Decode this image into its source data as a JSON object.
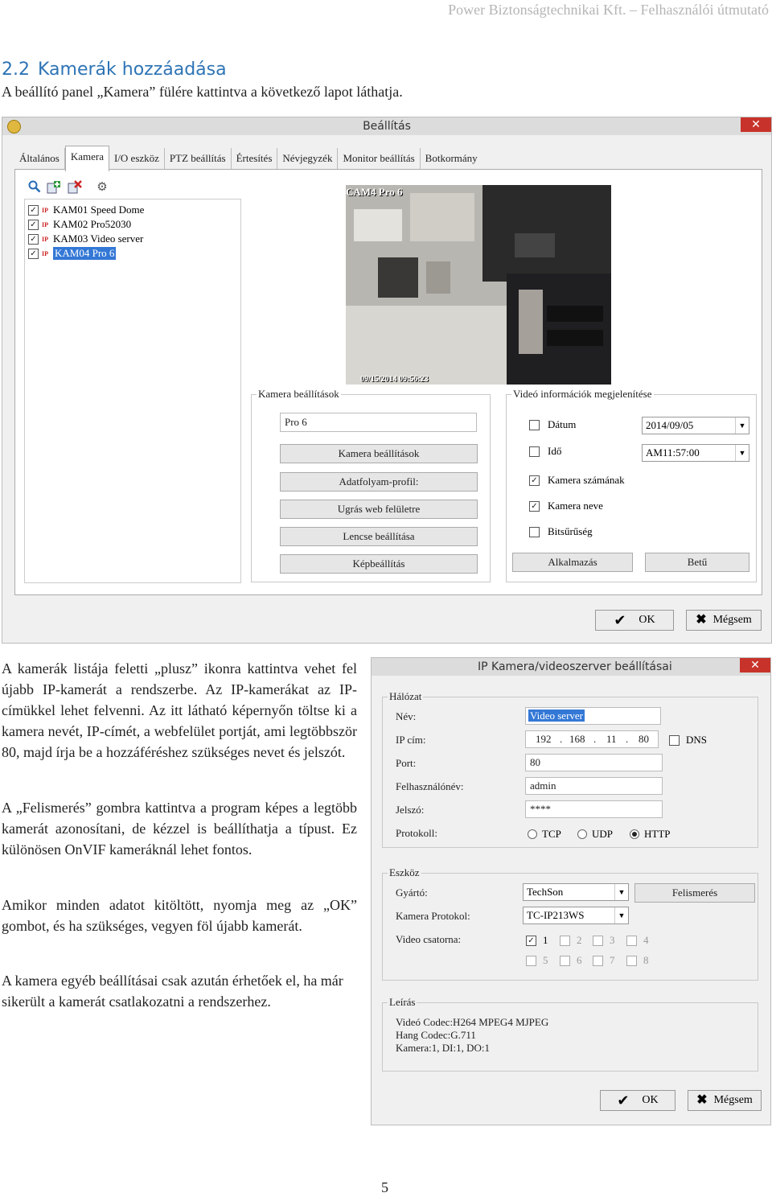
{
  "header": "Power Biztonságtechnikai Kft. – Felhasználói útmutató",
  "section": {
    "number": "2.2",
    "title": "Kamerák hozzáadása"
  },
  "intro": "A beállító panel „Kamera” fülére kattintva a következő lapot láthatja.",
  "settings_window": {
    "title": "Beállítás",
    "close": "✕",
    "tabs": [
      "Általános",
      "Kamera",
      "I/O eszköz",
      "PTZ beállítás",
      "Értesítés",
      "Névjegyzék",
      "Monitor beállítás",
      "Botkormány"
    ],
    "active_tab": "Kamera",
    "toolbar_icons": [
      "search-icon",
      "add-icon",
      "delete-icon",
      "gear-icon"
    ],
    "cameras": [
      {
        "tag": "IP",
        "label": "KAM01 Speed Dome",
        "checked": true
      },
      {
        "tag": "IP",
        "label": "KAM02 Pro52030",
        "checked": true
      },
      {
        "tag": "IP",
        "label": "KAM03 Video server",
        "checked": true
      },
      {
        "tag": "IP",
        "label": "KAM04 Pro 6",
        "checked": true,
        "selected": true
      }
    ],
    "video_overlay": {
      "camera_label": "CAM4 Pro 6",
      "timestamp": "09/15/2014 09:56:23"
    },
    "camera_settings": {
      "legend": "Kamera beállítások",
      "name_value": "Pro 6",
      "buttons": [
        "Kamera beállítások",
        "Adatfolyam-profil:",
        "Ugrás web felületre",
        "Lencse beállítása",
        "Képbeállítás"
      ]
    },
    "video_info": {
      "legend": "Videó információk megjelenítése",
      "date_label": "Dátum",
      "date_value": "2014/09/05",
      "time_label": "Idő",
      "time_value": "AM11:57:00",
      "camera_number_label": "Kamera számának",
      "camera_name_label": "Kamera neve",
      "bitrate_label": "Bitsűrűség",
      "apply_button": "Alkalmazás",
      "font_button": "Betű"
    },
    "ok": "OK",
    "cancel": "Mégsem"
  },
  "paragraphs": [
    "A kamerák listája feletti „plusz” ikonra kattintva vehet fel újabb IP-kamerát a rendszerbe. Az IP-kamerákat az IP-címükkel lehet felvenni. Az itt látható képernyőn töltse ki a kamera nevét, IP-címét, a webfelület portját, ami legtöbbször 80, majd írja be a hozzáféréshez szükséges nevet és jelszót.",
    "A „Felismerés” gombra kattintva a program képes a legtöbb kamerát azonosítani, de kézzel is beállíthatja a típust. Ez különösen OnVIF kameráknál lehet fontos.",
    "Amikor minden adatot kitöltött, nyomja meg az „OK” gombot, és ha szükséges, vegyen föl újabb kamerát.",
    "A kamera egyéb beállításai csak azután érhetőek el, ha már sikerült a kamerát csatlakozatni a rendszerhez."
  ],
  "ip_window": {
    "title": "IP Kamera/videoszerver beállításai",
    "close": "✕",
    "network_legend": "Hálózat",
    "name_label": "Név:",
    "name_value": "Video server",
    "ip_label": "IP cím:",
    "ip_parts": [
      "192",
      "168",
      "11",
      "80"
    ],
    "ip_dots": [
      ".",
      ".",
      "."
    ],
    "dns_label": "DNS",
    "port_label": "Port:",
    "port_value": "80",
    "user_label": "Felhasználónév:",
    "user_value": "admin",
    "password_label": "Jelszó:",
    "password_value": "****",
    "protocol_label": "Protokoll:",
    "protocols": [
      "TCP",
      "UDP",
      "HTTP"
    ],
    "selected_protocol": "HTTP",
    "device_legend": "Eszköz",
    "vendor_label": "Gyártó:",
    "vendor_value": "TechSon",
    "detect_button": "Felismerés",
    "camera_protocol_label": "Kamera Protokol:",
    "camera_protocol_value": "TC-IP213WS",
    "video_channel_label": "Video csatorna:",
    "channels": [
      "1",
      "2",
      "3",
      "4",
      "5",
      "6",
      "7",
      "8"
    ],
    "description_legend": "Leírás",
    "description_lines": [
      "Videó Codec:H264 MPEG4 MJPEG",
      "Hang Codec:G.711",
      "Kamera:1, DI:1, DO:1"
    ],
    "ok": "OK",
    "cancel": "Mégsem"
  },
  "page_number": "5"
}
